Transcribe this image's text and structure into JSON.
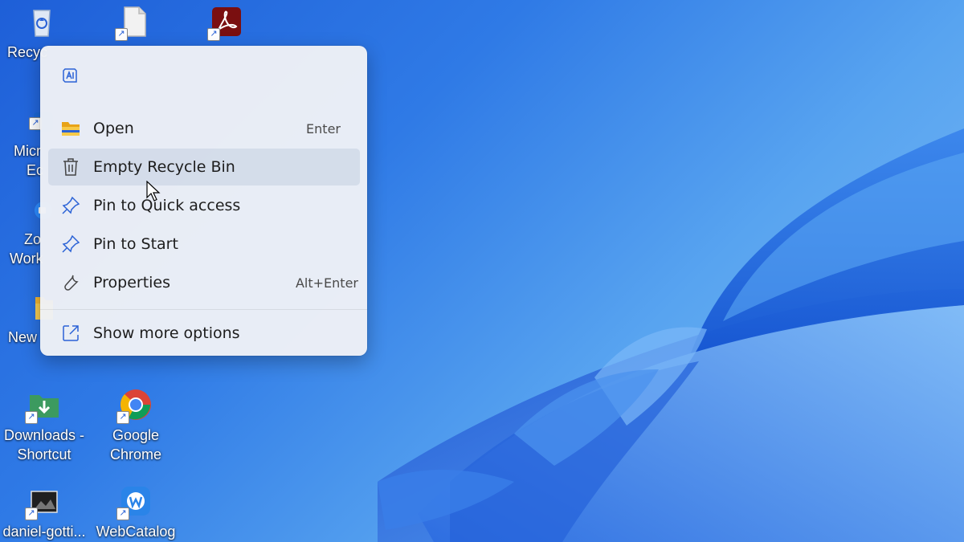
{
  "desktop": {
    "icons": [
      {
        "name": "Recycle Bin",
        "label": "Recycle Bin"
      },
      {
        "name": "Document",
        "label": "Document"
      },
      {
        "name": "Adobe Acrobat",
        "label": "Acrobat"
      },
      {
        "name": "Microsoft Edge",
        "label": "Microsoft Edge"
      },
      {
        "name": "Zoom Workplace",
        "label": "Zoom Workplace"
      },
      {
        "name": "New folder",
        "label": "New folder"
      },
      {
        "name": "Downloads - Shortcut",
        "label1": "Downloads -",
        "label2": "Shortcut"
      },
      {
        "name": "Google Chrome",
        "label1": "Google",
        "label2": "Chrome"
      },
      {
        "name": "daniel-gotti",
        "label": "daniel-gotti..."
      },
      {
        "name": "WebCatalog",
        "label": "WebCatalog"
      }
    ]
  },
  "visible_partial_labels": {
    "recycle": "Recyc",
    "edge_line1": "Micr",
    "edge_line2": "Ec",
    "zoom_line1": "Zo",
    "zoom_line2": "Work",
    "newfolder": "New"
  },
  "context_menu": {
    "top_icon": "ai-icon",
    "items": [
      {
        "label": "Open",
        "shortcut": "Enter",
        "icon": "folder-icon"
      },
      {
        "label": "Empty Recycle Bin",
        "shortcut": "",
        "icon": "trash-icon"
      },
      {
        "label": "Pin to Quick access",
        "shortcut": "",
        "icon": "pin-icon"
      },
      {
        "label": "Pin to Start",
        "shortcut": "",
        "icon": "pin-icon"
      },
      {
        "label": "Properties",
        "shortcut": "Alt+Enter",
        "icon": "wrench-icon"
      },
      {
        "label": "Show more options",
        "shortcut": "",
        "icon": "external-icon"
      }
    ],
    "hovered_index": 1
  },
  "colors": {
    "wallpaper_dark": "#1e5fd8",
    "wallpaper_light": "#7fbcf6",
    "menu_bg": "#eef1f6",
    "accent": "#2a62d6"
  }
}
